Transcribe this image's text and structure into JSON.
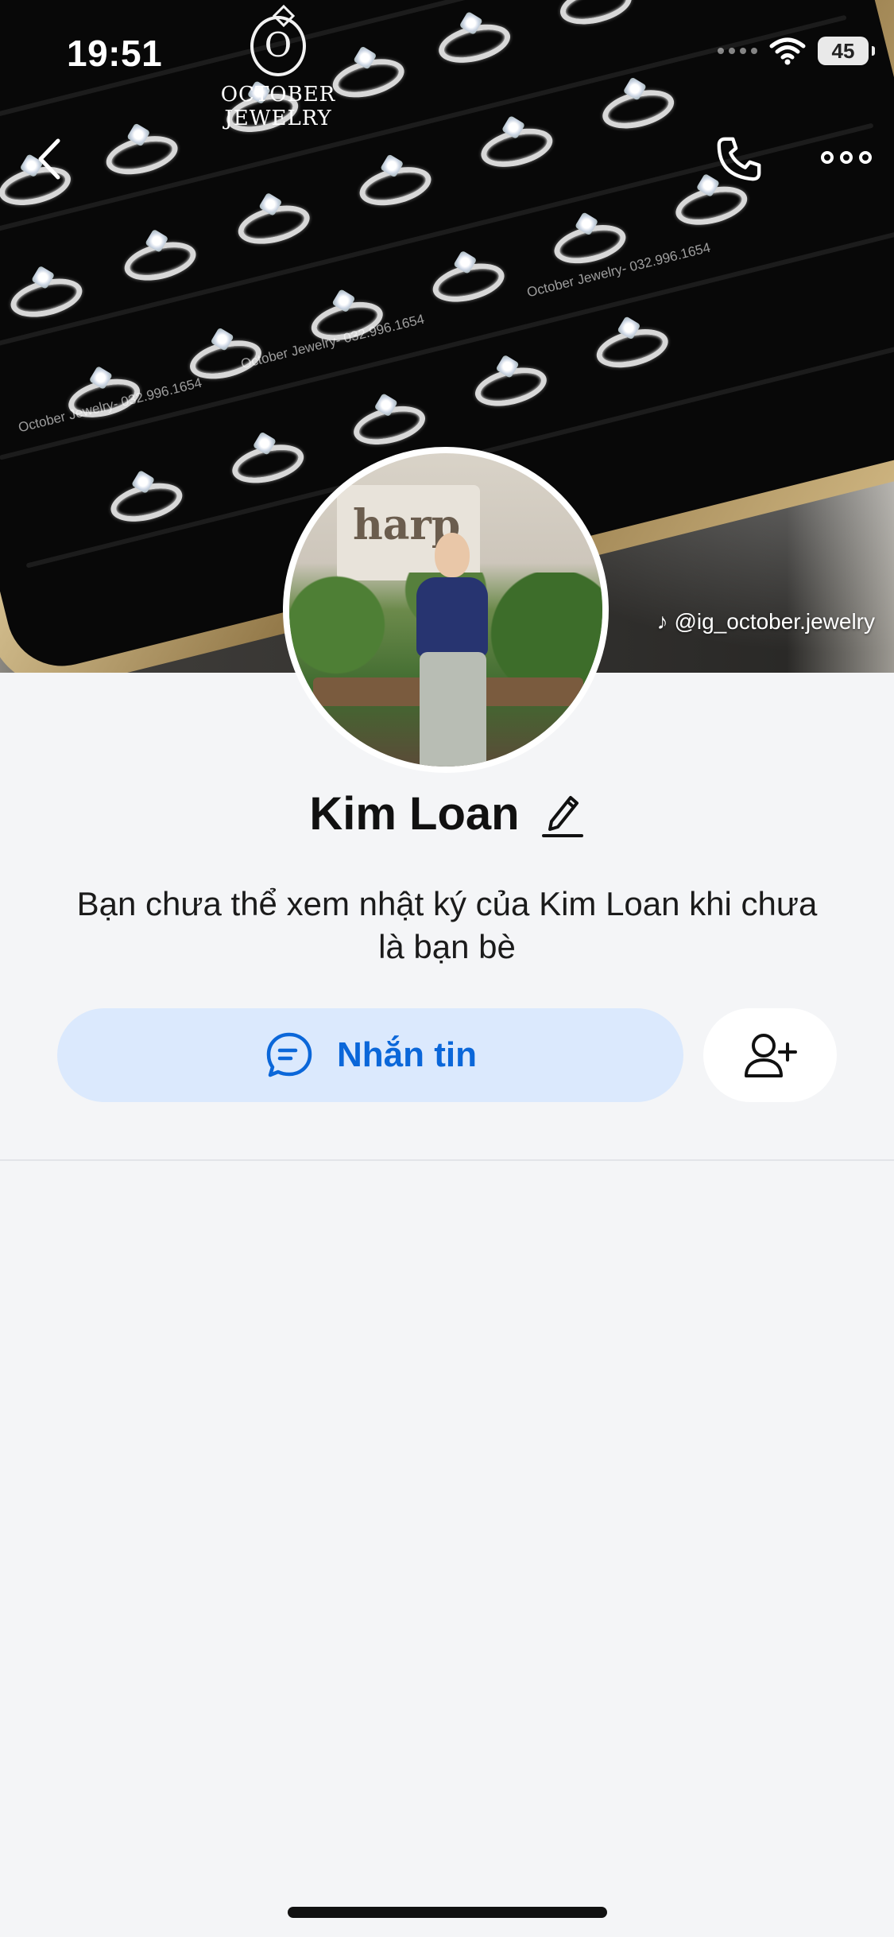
{
  "status": {
    "time": "19:51",
    "battery": "45"
  },
  "cover": {
    "brand_name": "OCTOBER JEWELRY",
    "brand_initial": "O",
    "watermark": "October Jewelry- 032.996.1654",
    "social_handle": "@ig_october.jewelry"
  },
  "avatar": {
    "sign_text": "harp"
  },
  "profile": {
    "name": "Kim Loan",
    "notice": "Bạn chưa thể xem nhật ký của Kim Loan khi chưa là bạn bè"
  },
  "actions": {
    "message_label": "Nhắn tin"
  },
  "icons": {
    "back": "chevron-left-icon",
    "call": "phone-icon",
    "more": "more-horizontal-icon",
    "edit": "pencil-icon",
    "message": "chat-bubble-icon",
    "add_friend": "user-plus-icon"
  },
  "colors": {
    "accent": "#0b67d9",
    "accent_bg": "#dbe9fd",
    "page_bg": "#f4f5f7"
  }
}
